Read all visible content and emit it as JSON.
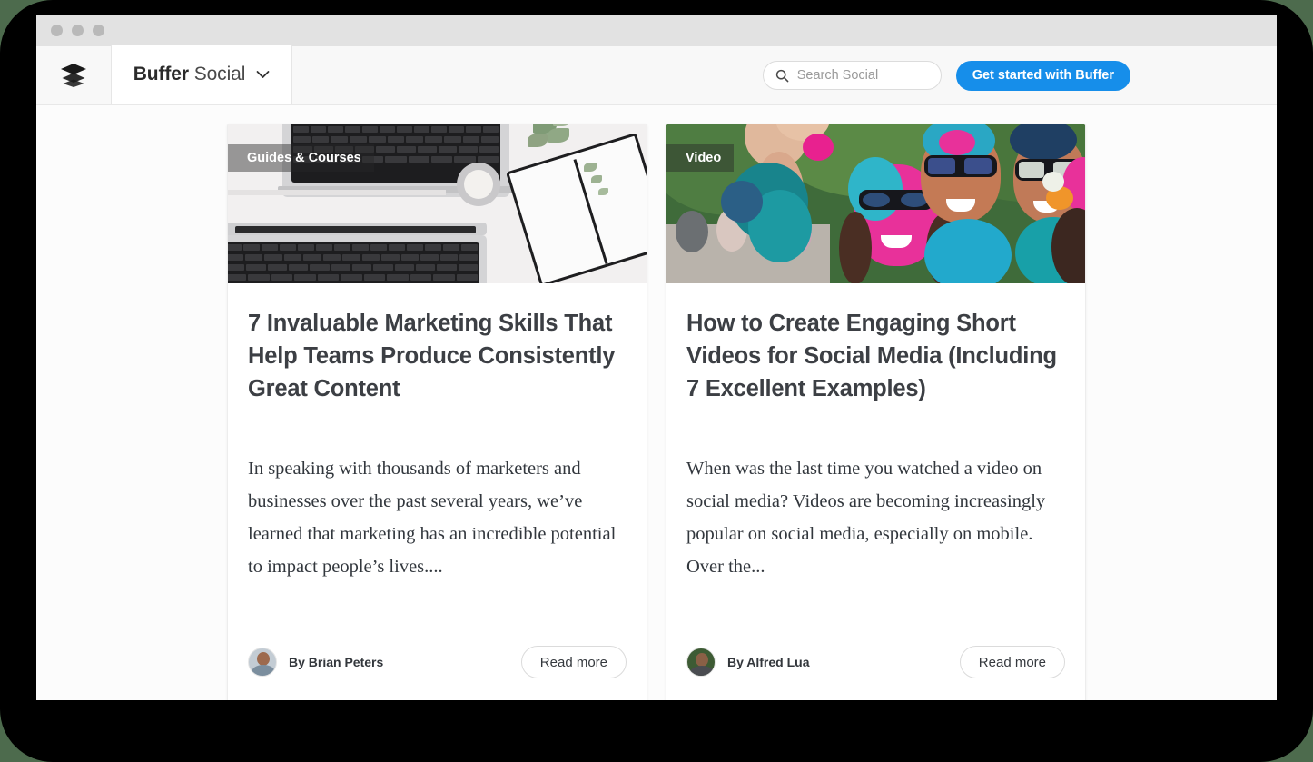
{
  "window": {
    "traffic_lights": [
      "close",
      "minimize",
      "maximize"
    ]
  },
  "header": {
    "logo_icon": "buffer-layers-icon",
    "brand_bold": "Buffer",
    "brand_light": "Social",
    "brand_chevron_icon": "chevron-down-icon",
    "search": {
      "icon": "search-icon",
      "placeholder": "Search Social",
      "value": ""
    },
    "cta_label": "Get started with Buffer",
    "cta_color": "#168eea"
  },
  "cards": [
    {
      "badge": "Guides & Courses",
      "image_alt": "flat-lay desk with two laptops, candle, plant and open notebook",
      "title": "7 Invaluable Marketing Skills That Help Teams Produce Consistently Great Content",
      "excerpt": "In speaking with thousands of marketers and businesses over the past several years, we’ve learned that marketing has an incredible potential to impact people’s lives....",
      "author_prefix": "By",
      "author": "By Brian Peters",
      "read_more": "Read more"
    },
    {
      "badge": "Video",
      "image_alt": "group of friends covered in colorful Holi powder taking a selfie",
      "title": "How to Create Engaging Short Videos for Social Media (Including 7 Excellent Examples)",
      "excerpt": "When was the last time you watched a video on social media? Videos are becoming increasingly popular on social media, especially on mobile. Over the...",
      "author_prefix": "By",
      "author": "By Alfred Lua",
      "read_more": "Read more"
    }
  ],
  "colors": {
    "page_background": "#fcfcfc",
    "outer_background": "#4d6b4d",
    "bezel": "#000000",
    "titlebar": "#e2e2e2",
    "header_background": "#f8f8f8",
    "title_text": "#3c3f44",
    "body_text": "#32373d"
  }
}
